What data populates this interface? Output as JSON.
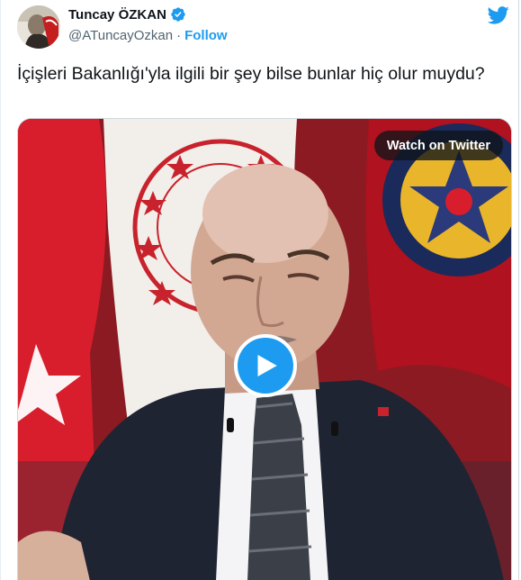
{
  "author": {
    "name": "Tuncay ÖZKAN",
    "handle": "@ATuncayOzkan",
    "separator": "·",
    "follow_label": "Follow",
    "verified": true
  },
  "tweet": {
    "text": "İçişleri Bakanlığı'yla ilgili bir şey bilse bunlar hiç olur muydu?"
  },
  "media": {
    "watch_label": "Watch on Twitter",
    "play_icon": "play-icon"
  },
  "colors": {
    "accent": "#1d9bf0",
    "text": "#0f1419",
    "secondary": "#536471"
  },
  "icons": [
    "avatar",
    "verified-badge-icon",
    "twitter-bird-icon",
    "play-icon"
  ]
}
